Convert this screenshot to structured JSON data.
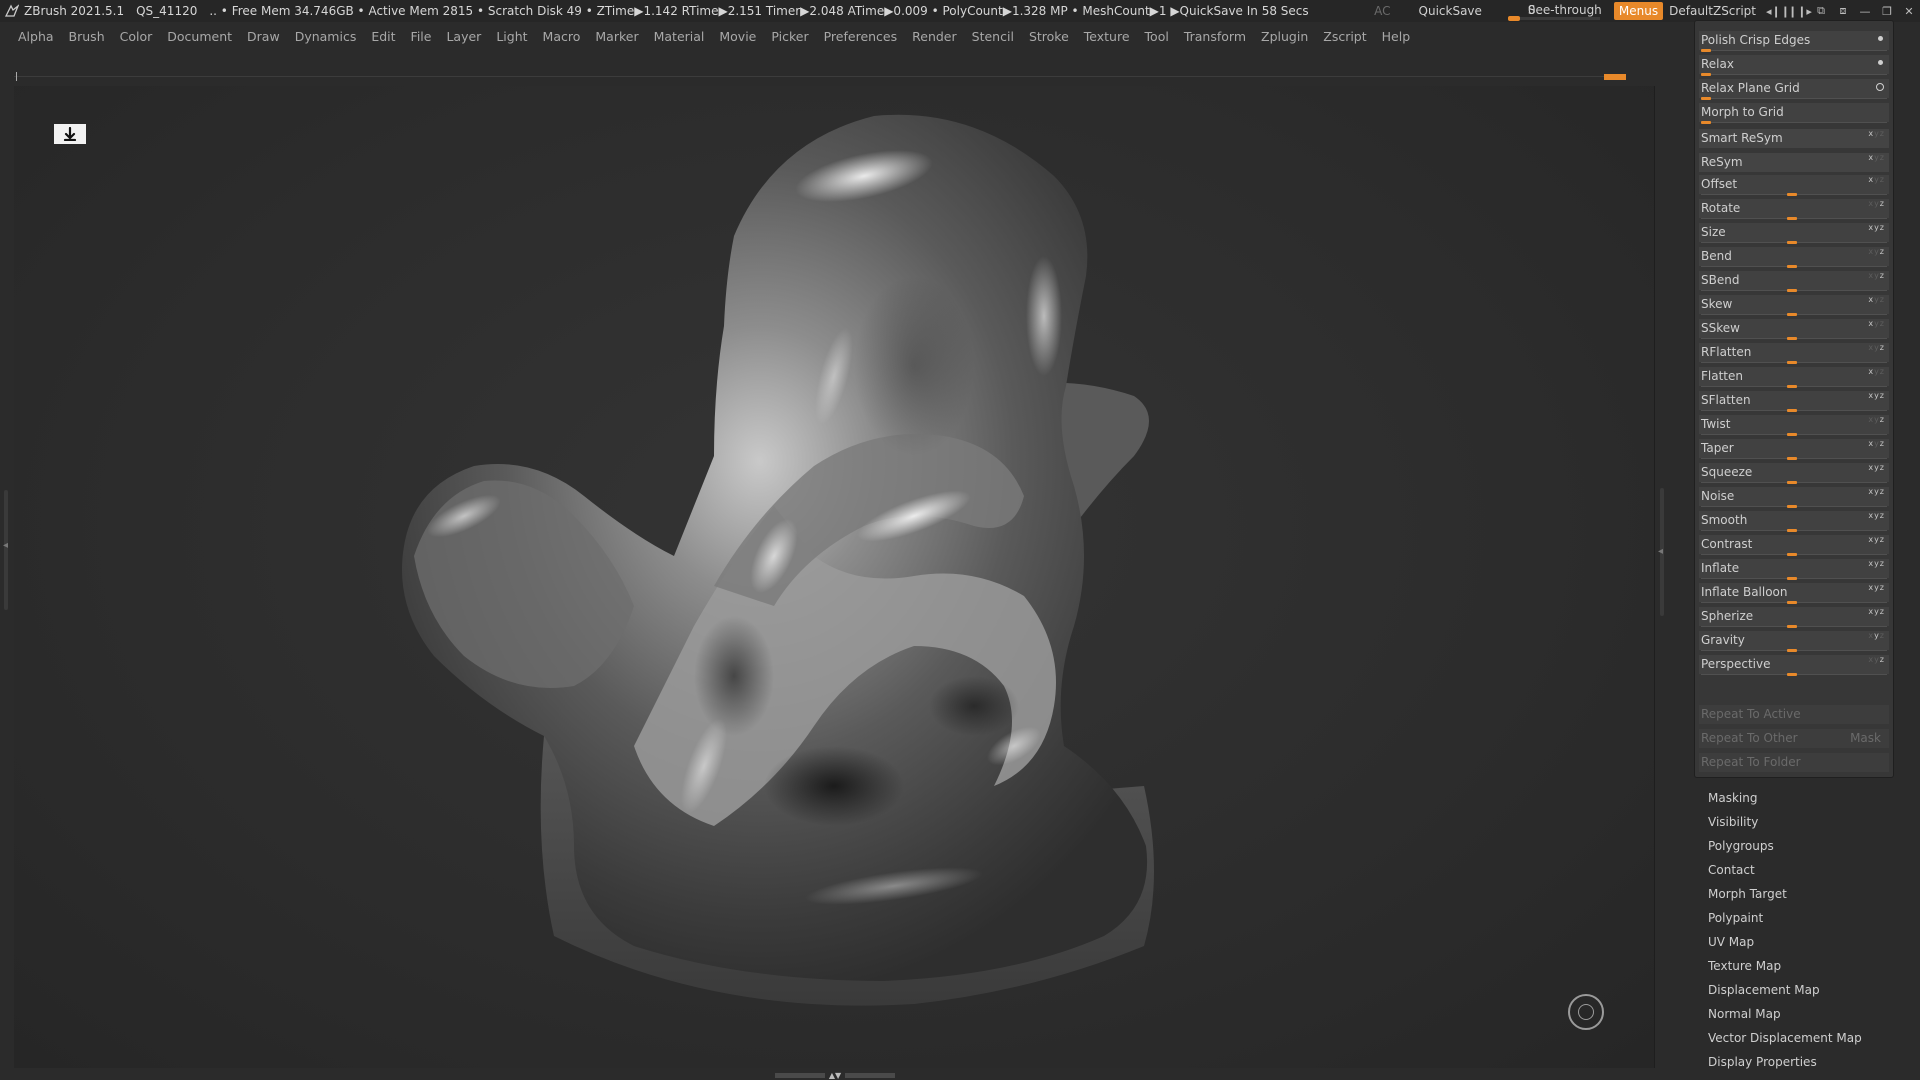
{
  "titlebar": {
    "app_title": "ZBrush 2021.5.1",
    "doc_name": "QS_41120",
    "status": ".. • Free Mem 34.746GB • Active Mem 2815 • Scratch Disk 49 •  ZTime▶1.142 RTime▶2.151 Timer▶2.048 ATime▶0.009 • PolyCount▶1.328 MP  • MeshCount▶1   ▶QuickSave In 58 Secs",
    "ac": "AC",
    "quicksave": "QuickSave",
    "see_through": "See-through",
    "see_through_value": "0",
    "menus": "Menus",
    "default_zscript": "DefaultZScript"
  },
  "menubar": [
    "Alpha",
    "Brush",
    "Color",
    "Document",
    "Draw",
    "Dynamics",
    "Edit",
    "File",
    "Layer",
    "Light",
    "Macro",
    "Marker",
    "Material",
    "Movie",
    "Picker",
    "Preferences",
    "Render",
    "Stencil",
    "Stroke",
    "Texture",
    "Tool",
    "Transform",
    "Zplugin",
    "Zscript",
    "Help"
  ],
  "deformation_panel": {
    "polish_crisp_edges": "Polish Crisp Edges",
    "relax": "Relax",
    "relax_plane_grid": "Relax Plane Grid",
    "morph_to_grid": "Morph to Grid",
    "smart_resym": "Smart ReSym",
    "resym": "ReSym",
    "sliders": [
      {
        "label": "Offset",
        "value": 0,
        "axes": "xyz",
        "active": [
          true,
          false,
          false
        ]
      },
      {
        "label": "Rotate",
        "value": 0,
        "axes": "xyz",
        "active": [
          false,
          false,
          true
        ]
      },
      {
        "label": "Size",
        "value": 0,
        "axes": "xyz",
        "active": [
          true,
          true,
          true
        ]
      },
      {
        "label": "Bend",
        "value": 0,
        "axes": "xyz",
        "active": [
          false,
          false,
          true
        ]
      },
      {
        "label": "SBend",
        "value": 0,
        "axes": "xyz",
        "active": [
          false,
          false,
          true
        ]
      },
      {
        "label": "Skew",
        "value": 0,
        "axes": "xyz",
        "active": [
          true,
          false,
          false
        ]
      },
      {
        "label": "SSkew",
        "value": 0,
        "axes": "xyz",
        "active": [
          true,
          false,
          false
        ]
      },
      {
        "label": "RFlatten",
        "value": 0,
        "axes": "xyz",
        "active": [
          false,
          false,
          true
        ]
      },
      {
        "label": "Flatten",
        "value": 0,
        "axes": "xyz",
        "active": [
          true,
          false,
          false
        ]
      },
      {
        "label": "SFlatten",
        "value": 0,
        "axes": "xyz",
        "active": [
          true,
          true,
          true
        ]
      },
      {
        "label": "Twist",
        "value": 0,
        "axes": "xyz",
        "active": [
          false,
          false,
          true
        ]
      },
      {
        "label": "Taper",
        "value": 0,
        "axes": "xyz",
        "active": [
          true,
          false,
          true
        ]
      },
      {
        "label": "Squeeze",
        "value": 0,
        "axes": "xyz",
        "active": [
          true,
          true,
          true
        ]
      },
      {
        "label": "Noise",
        "value": 0,
        "axes": "xyz",
        "active": [
          true,
          true,
          true
        ]
      },
      {
        "label": "Smooth",
        "value": 0,
        "axes": "xyz",
        "active": [
          true,
          true,
          true
        ]
      },
      {
        "label": "Contrast",
        "value": 0,
        "axes": "xyz",
        "active": [
          true,
          true,
          true
        ]
      },
      {
        "label": "Inflate",
        "value": 0,
        "axes": "xyz",
        "active": [
          true,
          true,
          true
        ]
      },
      {
        "label": "Inflate Balloon",
        "value": 0,
        "axes": "xyz",
        "active": [
          true,
          true,
          true
        ]
      },
      {
        "label": "Spherize",
        "value": 0,
        "axes": "xyz",
        "active": [
          true,
          true,
          true
        ]
      },
      {
        "label": "Gravity",
        "value": 0,
        "axes": "xyz",
        "active": [
          false,
          true,
          false
        ]
      },
      {
        "label": "Perspective",
        "value": 0,
        "axes": "xyz",
        "active": [
          false,
          false,
          true
        ]
      }
    ],
    "repeat_to_active": "Repeat To Active",
    "repeat_to_other": "Repeat To Other",
    "mask": "Mask",
    "repeat_to_folder": "Repeat To Folder"
  },
  "tool_sections": [
    "Masking",
    "Visibility",
    "Polygroups",
    "Contact",
    "Morph Target",
    "Polypaint",
    "UV Map",
    "Texture Map",
    "Displacement Map",
    "Normal Map",
    "Vector Displacement Map",
    "Display Properties"
  ],
  "colors": {
    "accent": "#e8892a",
    "background": "#2b2b2b",
    "panel": "#373737"
  }
}
